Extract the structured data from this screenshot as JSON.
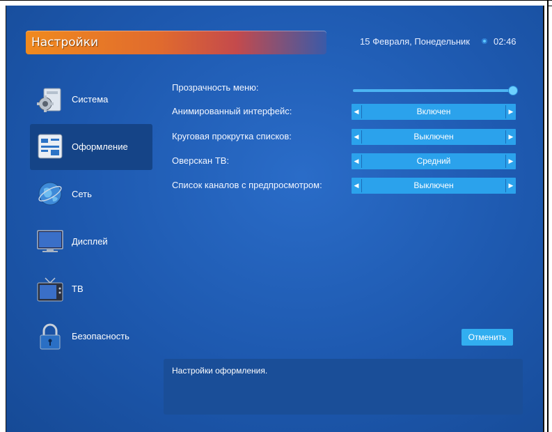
{
  "header": {
    "title": "Настройки",
    "date": "15 Февраля, Понедельник",
    "time": "02:46"
  },
  "sidebar": {
    "items": [
      {
        "label": "Система",
        "icon": "gear-icon",
        "active": false
      },
      {
        "label": "Оформление",
        "icon": "layout-icon",
        "active": true
      },
      {
        "label": "Сеть",
        "icon": "globe-icon",
        "active": false
      },
      {
        "label": "Дисплей",
        "icon": "monitor-icon",
        "active": false
      },
      {
        "label": "ТВ",
        "icon": "tv-icon",
        "active": false
      },
      {
        "label": "Безопасность",
        "icon": "lock-icon",
        "active": false
      }
    ]
  },
  "settings": {
    "transparency": {
      "label": "Прозрачность меню:",
      "level_percent": 100
    },
    "rows": [
      {
        "label": "Анимированный интерфейс:",
        "value": "Включен"
      },
      {
        "label": "Круговая прокрутка списков:",
        "value": "Выключен"
      },
      {
        "label": "Оверскан ТВ:",
        "value": "Средний"
      },
      {
        "label": "Список каналов с предпросмотром:",
        "value": "Выключен"
      }
    ]
  },
  "actions": {
    "cancel_label": "Отменить"
  },
  "description": {
    "text": "Настройки оформления."
  },
  "colors": {
    "background": "#1d58ae",
    "accent_orange": "#f08a1e",
    "selector": "#2ba2ec"
  }
}
